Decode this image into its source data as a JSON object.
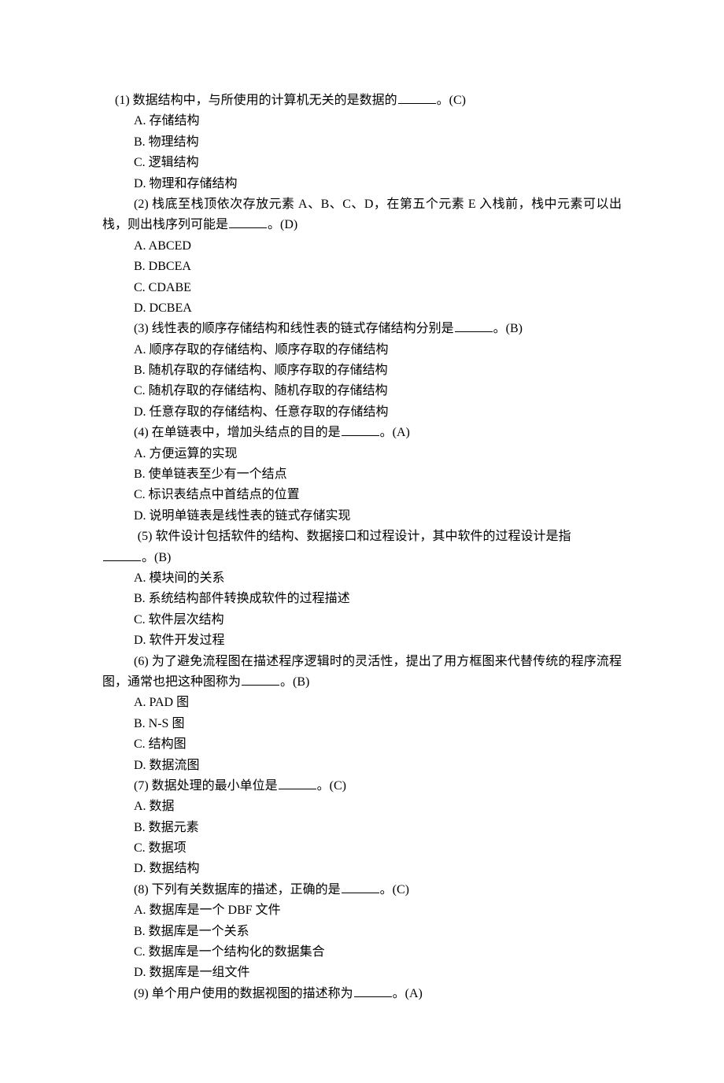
{
  "questions": [
    {
      "num": "(1)",
      "stem_pre": "数据结构中，与所使用的计算机无关的是数据的",
      "stem_post": "。(C)",
      "options": [
        "A. 存储结构",
        "B. 物理结构",
        "C. 逻辑结构",
        "D. 物理和存储结构"
      ],
      "first_question": true
    },
    {
      "num": "(2)",
      "stem_pre": "栈底至栈顶依次存放元素 A、B、C、D，在第五个元素 E 入栈前，栈中元素可以出栈，则出栈序列可能是",
      "stem_post": "。(D)",
      "wrap": true,
      "options": [
        "A. ABCED",
        "B. DBCEA",
        "C. CDABE",
        "D. DCBEA"
      ]
    },
    {
      "num": "(3)",
      "stem_pre": "线性表的顺序存储结构和线性表的链式存储结构分别是",
      "stem_post": "。(B)",
      "options": [
        "A. 顺序存取的存储结构、顺序存取的存储结构",
        "B. 随机存取的存储结构、顺序存取的存储结构",
        "C. 随机存取的存储结构、随机存取的存储结构",
        "D. 任意存取的存储结构、任意存取的存储结构"
      ]
    },
    {
      "num": "(4)",
      "stem_pre": "在单链表中，增加头结点的目的是",
      "stem_post": "。(A)",
      "options": [
        "A. 方便运算的实现",
        "B. 使单链表至少有一个结点",
        "C. 标识表结点中首结点的位置",
        "D. 说明单链表是线性表的链式存储实现"
      ]
    },
    {
      "num": "(5)",
      "stem_pre": "软件设计包括软件的结构、数据接口和过程设计，其中软件的过程设计是指",
      "stem_post": "。(B)",
      "wrap_tail": true,
      "tail_indent_extra": true,
      "options": [
        "A. 模块间的关系",
        "B. 系统结构部件转换成软件的过程描述",
        "C. 软件层次结构",
        "D. 软件开发过程"
      ]
    },
    {
      "num": "(6)",
      "stem_pre": "为了避免流程图在描述程序逻辑时的灵活性，提出了用方框图来代替传统的程序流程图，通常也把这种图称为",
      "stem_post": "。(B)",
      "wrap": true,
      "options": [
        "A. PAD 图",
        "B. N-S 图",
        "C. 结构图",
        "D. 数据流图"
      ]
    },
    {
      "num": "(7)",
      "stem_pre": "数据处理的最小单位是",
      "stem_post": "。(C)",
      "options": [
        "A. 数据",
        "B. 数据元素",
        "C. 数据项",
        "D. 数据结构"
      ]
    },
    {
      "num": "(8)",
      "stem_pre": "下列有关数据库的描述，正确的是",
      "stem_post": "。(C)",
      "options": [
        "A. 数据库是一个 DBF 文件",
        "B. 数据库是一个关系",
        "C. 数据库是一个结构化的数据集合",
        "D. 数据库是一组文件"
      ]
    },
    {
      "num": "(9)",
      "stem_pre": "单个用户使用的数据视图的描述称为",
      "stem_post": "。(A)",
      "options": []
    }
  ]
}
